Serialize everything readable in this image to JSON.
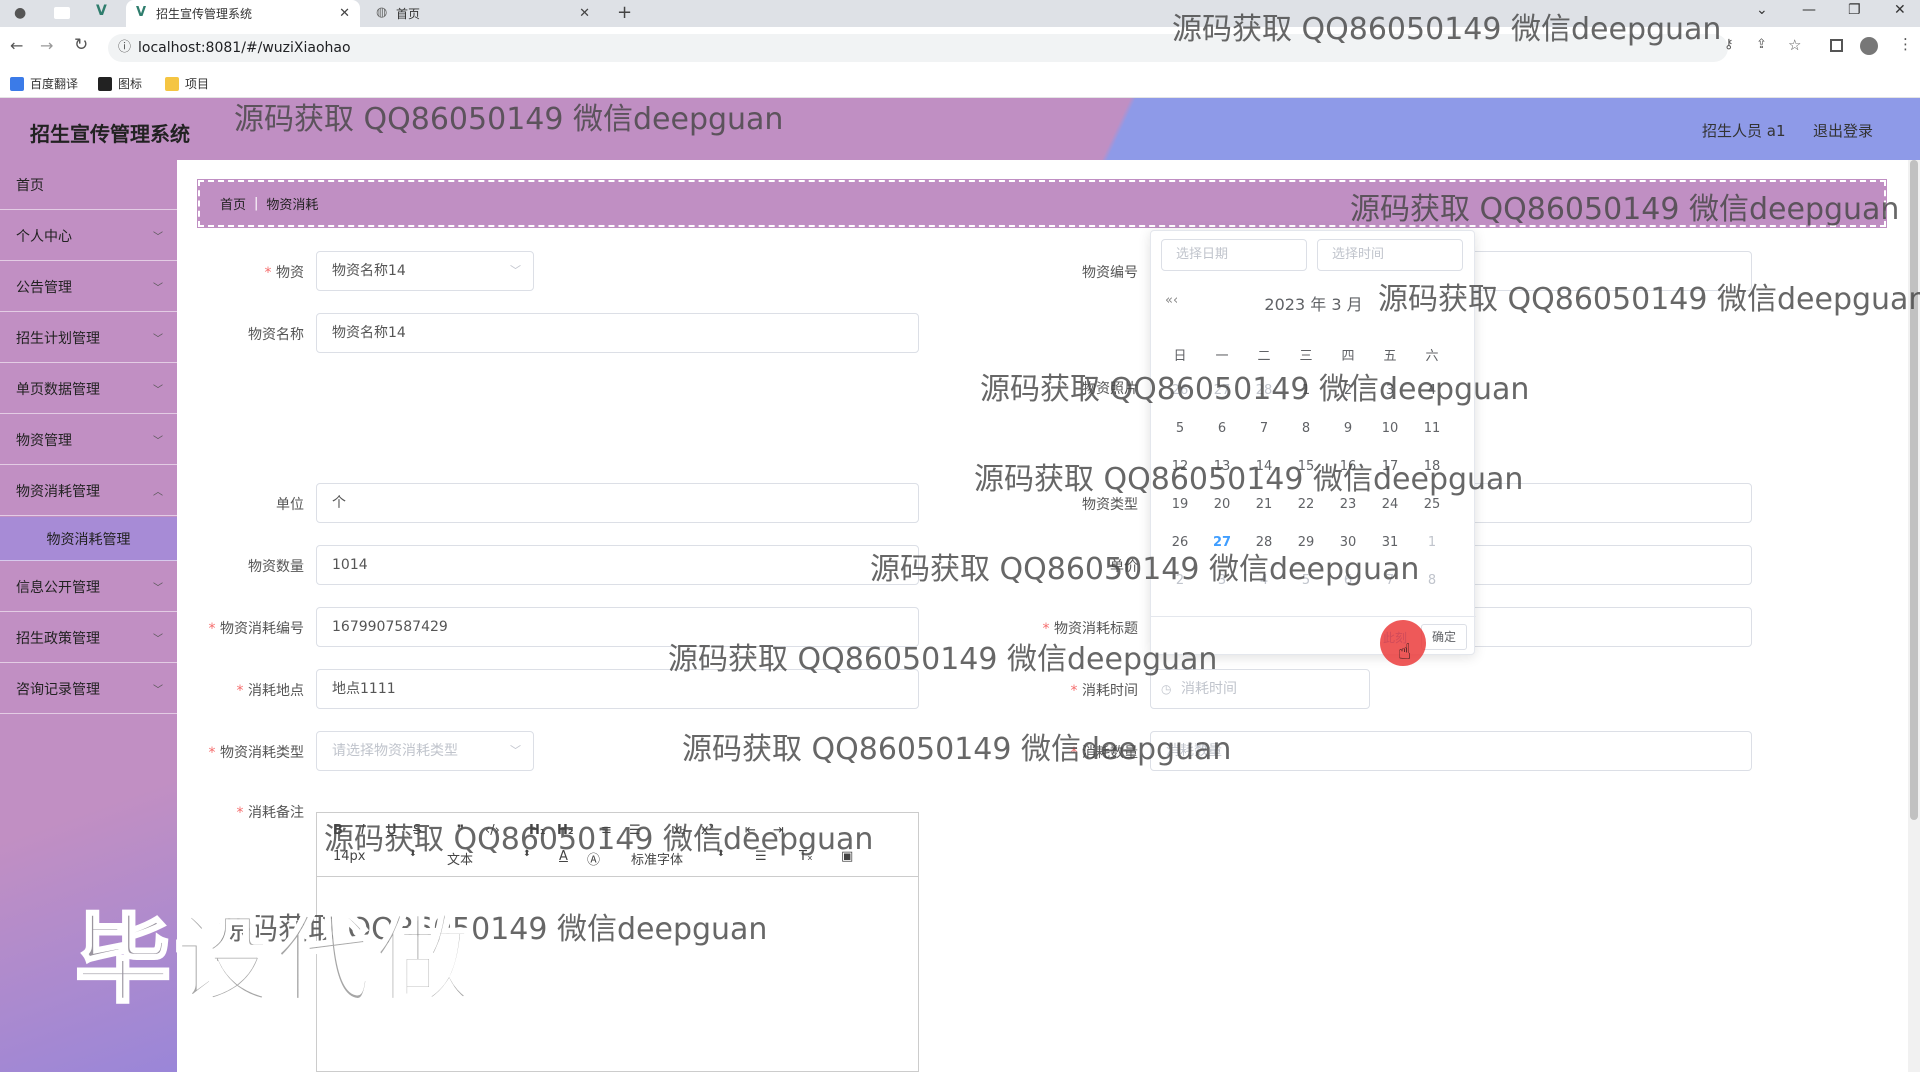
{
  "browser": {
    "tabs": [
      {
        "label": "招生宣传管理系统",
        "active": true
      },
      {
        "label": "首页",
        "active": false
      }
    ],
    "url": "localhost:8081/#/wuziXiaohao",
    "bookmarks": [
      "百度翻译",
      "图标",
      "项目"
    ]
  },
  "header": {
    "title": "招生宣传管理系统",
    "user": "招生人员 a1",
    "logout": "退出登录"
  },
  "sidebar": {
    "items": [
      {
        "label": "首页"
      },
      {
        "label": "个人中心"
      },
      {
        "label": "公告管理"
      },
      {
        "label": "招生计划管理"
      },
      {
        "label": "单页数据管理"
      },
      {
        "label": "物资管理"
      },
      {
        "label": "物资消耗管理"
      },
      {
        "label": "物资消耗管理"
      },
      {
        "label": "信息公开管理"
      },
      {
        "label": "招生政策管理"
      },
      {
        "label": "咨询记录管理"
      }
    ]
  },
  "breadcrumb": {
    "home": "首页",
    "current": "物资消耗"
  },
  "form": {
    "wuzi_label": "物资",
    "wuzi_value": "物资名称14",
    "wuzi_name_label": "物资名称",
    "wuzi_name_value": "物资名称14",
    "wuzi_no_label": "物资编号",
    "wuzi_photo_label": "物资照片",
    "unit_label": "单位",
    "unit_value": "个",
    "type_label": "物资类型",
    "qty_label": "物资数量",
    "qty_value": "1014",
    "price_label": "单价",
    "consume_no_label": "物资消耗编号",
    "consume_no_value": "1679907587429",
    "consume_title_label": "物资消耗标题",
    "place_label": "消耗地点",
    "place_value": "地点1111",
    "time_label": "消耗时间",
    "time_placeholder": "消耗时间",
    "consume_type_label": "物资消耗类型",
    "consume_type_placeholder": "请选择物资消耗类型",
    "consume_qty_label": "消耗数量",
    "consume_qty_placeholder": "消耗数量",
    "remark_label": "消耗备注"
  },
  "editor": {
    "font_size": "14px",
    "paragraph": "文本",
    "font_family": "标准字体"
  },
  "datepicker": {
    "date_placeholder": "选择日期",
    "time_placeholder": "选择时间",
    "year_label": "2023 年",
    "month_label": "3 月",
    "weekdays": [
      "日",
      "一",
      "二",
      "三",
      "四",
      "五",
      "六"
    ],
    "weeks": [
      [
        "26",
        "27",
        "28",
        "1",
        "2",
        "3",
        "4"
      ],
      [
        "5",
        "6",
        "7",
        "8",
        "9",
        "10",
        "11"
      ],
      [
        "12",
        "13",
        "14",
        "15",
        "16",
        "17",
        "18"
      ],
      [
        "19",
        "20",
        "21",
        "22",
        "23",
        "24",
        "25"
      ],
      [
        "26",
        "27",
        "28",
        "29",
        "30",
        "31",
        "1"
      ],
      [
        "2",
        "3",
        "4",
        "5",
        "6",
        "7",
        "8"
      ]
    ],
    "today": "27",
    "now_label": "此刻",
    "ok_label": "确定"
  },
  "watermark": {
    "text": "源码获取 QQ86050149 微信deepguan",
    "big": "毕设代做"
  }
}
